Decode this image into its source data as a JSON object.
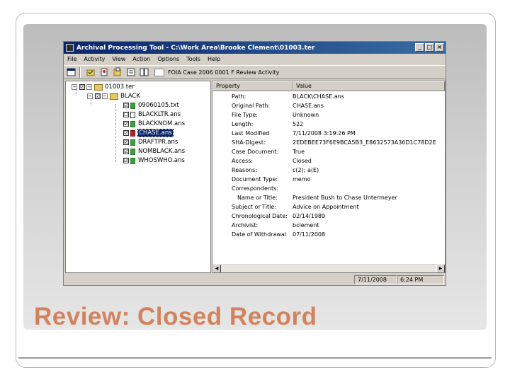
{
  "slide": {
    "title": "Review: Closed Record"
  },
  "window": {
    "title": "Archival Processing Tool - C:\\Work Area\\Brooke Clement\\01003.ter",
    "buttons": {
      "minimize": "_",
      "maximize": "□",
      "close": "×"
    }
  },
  "menu": [
    "File",
    "Activity",
    "View",
    "Action",
    "Options",
    "Tools",
    "Help"
  ],
  "toolbar": {
    "case_label": "FOIA Case 2006 0001 F Review Activity"
  },
  "tree": {
    "root": "01003.ter",
    "folder": "BLACK",
    "files": [
      {
        "name": "09060105.txt",
        "checked": "☑",
        "icon": "green"
      },
      {
        "name": "BLACKLTR.ans",
        "checked": "☐",
        "icon": "white"
      },
      {
        "name": "BLACKNOM.ans",
        "checked": "☑",
        "icon": "green"
      },
      {
        "name": "CHASE.ans",
        "checked": "☑",
        "icon": "red",
        "selected": true
      },
      {
        "name": "DRAFTPR.ans",
        "checked": "☑",
        "icon": "green"
      },
      {
        "name": "NOMBLACK.ans",
        "checked": "☑",
        "icon": "green"
      },
      {
        "name": "WHOSWHO.ans",
        "checked": "☑",
        "icon": "green"
      }
    ]
  },
  "properties": {
    "header": {
      "property": "Property",
      "value": "Value"
    },
    "rows": [
      {
        "key": "Path:",
        "value": "BLACK\\CHASE.ans"
      },
      {
        "key": "Original Path:",
        "value": "CHASE.ans"
      },
      {
        "key": "File Type:",
        "value": "Unknown"
      },
      {
        "key": "Length:",
        "value": "522"
      },
      {
        "key": "Last Modified",
        "value": "7/11/2008 3:19:26 PM"
      },
      {
        "key": "SHA-Digest:",
        "value": "2EDEBEE73F6E9BCA5B3_E8632573A36D1C78D2E"
      },
      {
        "key": "Case Document:",
        "value": "True"
      },
      {
        "key": "Access:",
        "value": "Closed"
      },
      {
        "key": "Reasons:",
        "value": "c(2); a(E)"
      },
      {
        "key": "Document Type:",
        "value": "memo"
      },
      {
        "key": "Correspondents:",
        "value": ""
      },
      {
        "key": "Name or Title:",
        "value": "President Bush to Chase Untermeyer",
        "indent": true
      },
      {
        "key": "Subject or Title:",
        "value": "Advice on Appointment"
      },
      {
        "key": "Chronological Date:",
        "value": "02/14/1989"
      },
      {
        "key": "Archivist:",
        "value": "bclement"
      },
      {
        "key": "Date of Withdrawal",
        "value": "07/11/2008"
      }
    ]
  },
  "status": {
    "date": "7/11/2008",
    "time": "6:24 PM"
  },
  "colors": {
    "title_accent": "#d2835d",
    "titlebar": "#0a246a",
    "selection": "#0a246a"
  }
}
